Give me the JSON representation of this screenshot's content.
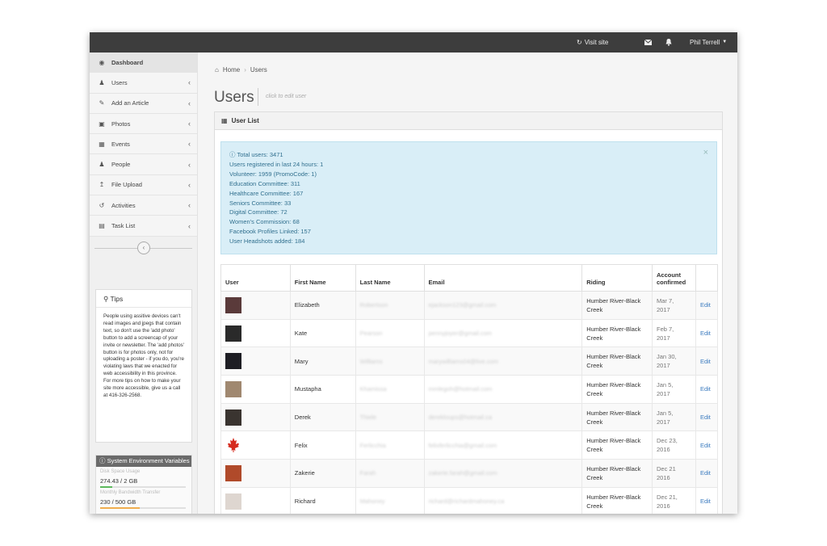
{
  "topbar": {
    "visit_site": "Visit site",
    "user_name": "Phil Terrell"
  },
  "sidebar": {
    "items": [
      {
        "label": "Dashboard",
        "icon": "dashboard-icon"
      },
      {
        "label": "Users",
        "icon": "users-icon"
      },
      {
        "label": "Add an Article",
        "icon": "edit-icon"
      },
      {
        "label": "Photos",
        "icon": "camera-icon"
      },
      {
        "label": "Events",
        "icon": "calendar-icon"
      },
      {
        "label": "People",
        "icon": "user-icon"
      },
      {
        "label": "File Upload",
        "icon": "upload-icon"
      },
      {
        "label": "Activities",
        "icon": "history-icon"
      },
      {
        "label": "Task List",
        "icon": "clipboard-icon"
      }
    ],
    "tips": {
      "title": "Tips",
      "body": "People using assitive devices can't read images and jpegs that contain text, so don't use the 'add photo' button to add a screencap of your invite or newsletter. The 'add photos' button is for photos only, not for uploading a poster - if you do, you're violating laws that we enacted for web accessibility in this province. For more tips on how to make your site more accessible, give us a call at 416-326-2568."
    },
    "sysenv": {
      "title": "System Environment Variables",
      "disk_label": "Disk Space Usage",
      "disk_value": "274.43 / 2 GB",
      "disk_fraction": 0.137,
      "bandwidth_label": "Monthly Bandwidth Transfer",
      "bandwidth_value": "230 / 500 GB",
      "bandwidth_fraction": 0.46,
      "colors": {
        "disk": "#5cb85c",
        "bandwidth": "#f0ad4e"
      }
    }
  },
  "breadcrumb": {
    "home": "Home",
    "current": "Users"
  },
  "page": {
    "title": "Users",
    "hint": "click to edit user"
  },
  "panel": {
    "title": "User List"
  },
  "alert": {
    "lines": [
      "Total users: 3471",
      "Users registered in last 24 hours: 1",
      "Volunteer: 1959 (PromoCode: 1)",
      "Education Committee: 311",
      "Healthcare Committee: 167",
      "Seniors Committee: 33",
      "Digital Committee: 72",
      "Women's Commission: 68",
      "Facebook Profiles Linked: 157",
      "User Headshots added: 184"
    ]
  },
  "table": {
    "headers": {
      "user": "User",
      "first": "First Name",
      "last": "Last Name",
      "email": "Email",
      "riding": "Riding",
      "confirmed_1": "Account",
      "confirmed_2": "confirmed"
    },
    "edit_label": "Edit",
    "rows": [
      {
        "first": "Elizabeth",
        "last": "Robertson",
        "email": "ejackson123@gmail.com",
        "riding_1": "Humber River-Black",
        "riding_2": "Creek",
        "date_1": "Mar 7,",
        "date_2": "2017",
        "avatar_color": "#5a3a3a"
      },
      {
        "first": "Kate",
        "last": "Pearson",
        "email": "pennyjoyer@gmail.com",
        "riding_1": "Humber River-Black",
        "riding_2": "Creek",
        "date_1": "Feb 7,",
        "date_2": "2017",
        "avatar_color": "#2a2a2a"
      },
      {
        "first": "Mary",
        "last": "Williams",
        "email": "marywilliams04@live.com",
        "riding_1": "Humber River-Black",
        "riding_2": "Creek",
        "date_1": "Jan 30,",
        "date_2": "2017",
        "avatar_color": "#1e1e24"
      },
      {
        "first": "Mustapha",
        "last": "Khamissa",
        "email": "mmlegoh@hotmail.com",
        "riding_1": "Humber River-Black",
        "riding_2": "Creek",
        "date_1": "Jan 5,",
        "date_2": "2017",
        "avatar_color": "#a08870"
      },
      {
        "first": "Derek",
        "last": "Thiele",
        "email": "derekloups@hotmail.ca",
        "riding_1": "Humber River-Black",
        "riding_2": "Creek",
        "date_1": "Jan 5,",
        "date_2": "2017",
        "avatar_color": "#3a3430"
      },
      {
        "first": "Felix",
        "last": "Ferlicchia",
        "email": "felixferlicchia@gmail.com",
        "riding_1": "Humber River-Black",
        "riding_2": "Creek",
        "date_1": "Dec 23,",
        "date_2": "2016",
        "avatar_color": "#d52b1e"
      },
      {
        "first": "Zakerie",
        "last": "Farah",
        "email": "zakerie.farah@gmail.com",
        "riding_1": "Humber River-Black",
        "riding_2": "Creek",
        "date_1": "Dec 21",
        "date_2": "2016",
        "avatar_color": "#b04a2a"
      },
      {
        "first": "Richard",
        "last": "Mahoney",
        "email": "richard@richardmahoney.ca",
        "riding_1": "Humber River-Black",
        "riding_2": "Creek",
        "date_1": "Dec 21,",
        "date_2": "2016",
        "avatar_color": "#ded6d0"
      }
    ]
  }
}
